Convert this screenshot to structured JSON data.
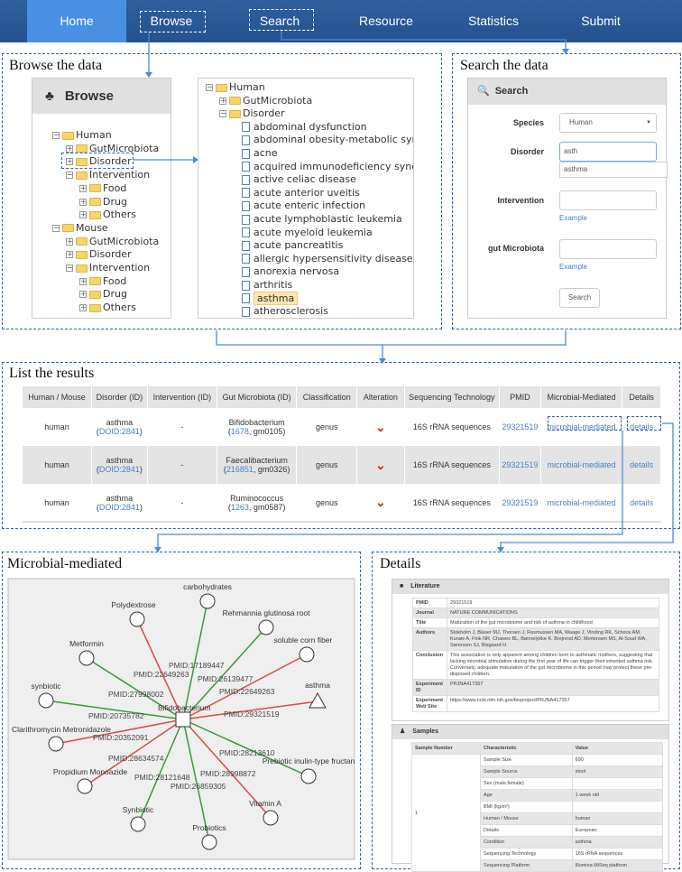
{
  "nav": {
    "items": [
      "Home",
      "Browse",
      "Search",
      "Resource",
      "Statistics",
      "Submit"
    ],
    "active": "Home"
  },
  "sections": {
    "browse": "Browse the data",
    "search": "Search the data",
    "results": "List the results",
    "microbial": "Microbial-mediated",
    "details": "Details"
  },
  "browse_panel": {
    "title": "Browse",
    "icon": "tree-icon",
    "tree": [
      [
        "Human",
        0,
        "-"
      ],
      [
        "GutMicrobiota",
        1,
        "+"
      ],
      [
        "Disorder",
        1,
        "+"
      ],
      [
        "Intervention",
        1,
        "-"
      ],
      [
        "Food",
        2,
        "+"
      ],
      [
        "Drug",
        2,
        "+"
      ],
      [
        "Others",
        2,
        "+"
      ],
      [
        "Mouse",
        0,
        "-"
      ],
      [
        "GutMicrobiota",
        1,
        "+"
      ],
      [
        "Disorder",
        1,
        "+"
      ],
      [
        "Intervention",
        1,
        "-"
      ],
      [
        "Food",
        2,
        "+"
      ],
      [
        "Drug",
        2,
        "+"
      ],
      [
        "Others",
        2,
        "+"
      ]
    ]
  },
  "disorder_tree": {
    "folders": [
      [
        "Human",
        0,
        "-"
      ],
      [
        "GutMicrobiota",
        1,
        "+"
      ],
      [
        "Disorder",
        1,
        "-"
      ]
    ],
    "items": [
      "abdominal dysfunction",
      "abdominal obesity-metabolic syndr",
      "acne",
      "acquired immunodeficiency syndror",
      "active celiac disease",
      "acute anterior uveitis",
      "acute enteric infection",
      "acute lymphoblastic leukemia",
      "acute myeloid leukemia",
      "acute pancreatitis",
      "allergic hypersensitivity disease",
      "anorexia nervosa",
      "arthritis",
      "asthma",
      "atherosclerosis"
    ],
    "selected": "asthma"
  },
  "search_panel": {
    "title": "Search",
    "species_label": "Species",
    "species_value": "Human",
    "disorder_label": "Disorder",
    "disorder_value": "asth",
    "suggestion": "asthma",
    "intervention_label": "Intervention",
    "intervention_value": "",
    "microbiota_label": "gut Microbiota",
    "microbiota_value": "",
    "example_label": "Example",
    "search_button": "Search"
  },
  "results": {
    "headers": [
      "Human / Mouse",
      "Disorder (ID)",
      "Intervention (ID)",
      "Gut Microbiota (ID)",
      "Classification",
      "Alteration",
      "Sequencing Technology",
      "PMID",
      "Microbial-Mediated",
      "Details"
    ],
    "rows": [
      {
        "species": "human",
        "disorder": "asthma",
        "doid": "DOID:2841",
        "intervention": "-",
        "microbe": "Bifidobacterium",
        "taxid": "1678",
        "gm": ", gm0105)",
        "classification": "genus",
        "alteration": "down",
        "tech": "16S rRNA sequences",
        "pmid": "29321519",
        "mm": "microbial-mediated",
        "details": "details"
      },
      {
        "species": "human",
        "disorder": "asthma",
        "doid": "DOID:2841",
        "intervention": "-",
        "microbe": "Faecalibacterium",
        "taxid": "216851",
        "gm": ", gm0326)",
        "classification": "genus",
        "alteration": "down",
        "tech": "16S rRNA sequences",
        "pmid": "29321519",
        "mm": "microbial-mediated",
        "details": "details"
      },
      {
        "species": "human",
        "disorder": "asthma",
        "doid": "DOID:2841",
        "intervention": "-",
        "microbe": "Ruminococcus",
        "taxid": "1263",
        "gm": ", gm0587)",
        "classification": "genus",
        "alteration": "down",
        "tech": "16S rRNA sequences",
        "pmid": "29321519",
        "mm": "microbial-mediated",
        "details": "details"
      }
    ]
  },
  "network": {
    "center": "Bifidobacterium",
    "colors": {
      "increase": "#3a9a3a",
      "decrease": "#e04848"
    },
    "nodes": [
      {
        "name": "carbohydrates",
        "pmid": "PMID:17189447",
        "relation": "increase",
        "shape": "circle"
      },
      {
        "name": "Polydextrose",
        "pmid": "PMID:22649263",
        "relation": "decrease",
        "shape": "circle"
      },
      {
        "name": "Rehmannia glutinosa root",
        "pmid": "PMID:26139477",
        "relation": "increase",
        "shape": "circle"
      },
      {
        "name": "soluble corn fiber",
        "pmid": "PMID:22649263",
        "relation": "decrease",
        "shape": "circle"
      },
      {
        "name": "Metformin",
        "pmid": "PMID:27998002",
        "relation": "increase",
        "shape": "circle"
      },
      {
        "name": "asthma",
        "pmid": "PMID:29321519",
        "relation": "decrease",
        "shape": "triangle"
      },
      {
        "name": "synbiotic",
        "pmid": "PMID:20735782",
        "relation": "increase",
        "shape": "circle"
      },
      {
        "name": "Clarithromycin Metronidazole",
        "pmid": "PMID:20352091",
        "relation": "decrease",
        "shape": "circle"
      },
      {
        "name": "Prebiotic inulin-type fructan",
        "pmid": "PMID:28213610",
        "relation": "increase",
        "shape": "circle"
      },
      {
        "name": "Propidium Monoazide",
        "pmid": "PMID:28634574",
        "relation": "decrease",
        "shape": "circle"
      },
      {
        "name": "Vitamin A",
        "pmid": "PMID:28998872",
        "relation": "decrease",
        "shape": "circle"
      },
      {
        "name": "Synbiotic",
        "pmid": "PMID:28121648",
        "relation": "increase",
        "shape": "circle"
      },
      {
        "name": "Probiotics",
        "pmid": "PMID:26859305",
        "relation": "increase",
        "shape": "circle"
      }
    ]
  },
  "details": {
    "literature_title": "Literature",
    "literature": [
      [
        "PMID",
        "29321519"
      ],
      [
        "Journal",
        "NATURE COMMUNICATIONS"
      ],
      [
        "Title",
        "Maturation of the gut microbiome and risk of asthma in childhood"
      ],
      [
        "Authors",
        "Stokholm J, Blaser MJ, Thorsen J, Rasmussen MA, Waage J, Vinding RK, Schoos AM, Kunøe A, Fink NR, Chawes BL, Bønnelykke K, Brejnrod AD, Mortensen MS, Al-Soud WA, Sørensen SJ, Bisgaard H"
      ],
      [
        "Conclusion",
        "This association is only apparent among children born to asthmatic mothers, suggesting that lacking microbial stimulation during the first year of life can trigger their inherited asthma risk. Conversely, adequate maturation of the gut microbiome in this period may protect these pre-disposed children."
      ],
      [
        "Experiment ID",
        "PRJNA417357"
      ],
      [
        "Experiment Web Site",
        "https://www.ncbi.nlm.nih.gov/bioproject/PRJNA417357"
      ]
    ],
    "samples_title": "Samples",
    "samples_headers": [
      "Sample Number",
      "Characteristic",
      "Value"
    ],
    "sample_number": "1",
    "samples": [
      [
        "Sample Size",
        "690"
      ],
      [
        "Sample Source",
        "stool"
      ],
      [
        "Sex (male,female)",
        ""
      ],
      [
        "Age",
        "1 week old"
      ],
      [
        "BMI (kg/m²)",
        ""
      ],
      [
        "Human / Mouse",
        "human"
      ],
      [
        "Details",
        "European"
      ],
      [
        "Condition",
        "asthma"
      ],
      [
        "Sequencing Technology",
        "16S rRNA sequences"
      ],
      [
        "Sequencing Platform",
        "Illumina MiSeq platform"
      ]
    ]
  }
}
